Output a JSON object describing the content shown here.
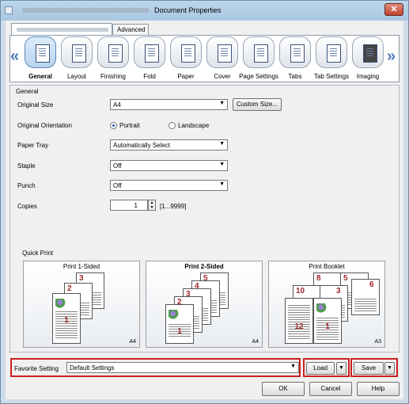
{
  "window": {
    "title": "Document Properties",
    "close_glyph": "✕"
  },
  "tabs": [
    {
      "label": "Advanced"
    }
  ],
  "categories": [
    {
      "label": "General",
      "selected": true
    },
    {
      "label": "Layout"
    },
    {
      "label": "Finishing"
    },
    {
      "label": "Fold"
    },
    {
      "label": "Paper"
    },
    {
      "label": "Cover"
    },
    {
      "label": "Page Settings"
    },
    {
      "label": "Tabs"
    },
    {
      "label": "Tab Settings"
    },
    {
      "label": "Imaging"
    }
  ],
  "nav": {
    "left": "«",
    "right": "»"
  },
  "general": {
    "group_title": "General",
    "original_size": {
      "label": "Original Size",
      "value": "A4",
      "custom_button": "Custom Size..."
    },
    "orientation": {
      "label": "Original Orientation",
      "portrait": "Portrait",
      "landscape": "Landscape",
      "selected": "Portrait"
    },
    "paper_tray": {
      "label": "Paper Tray",
      "value": "Automatically Select"
    },
    "staple": {
      "label": "Staple",
      "value": "Off"
    },
    "punch": {
      "label": "Punch",
      "value": "Off"
    },
    "copies": {
      "label": "Copies",
      "value": "1",
      "range": "[1...9999]"
    }
  },
  "quick_print": {
    "title": "Quick Print",
    "options": [
      {
        "label": "Print 1-Sided",
        "size": "A4",
        "pages": [
          "3",
          "2",
          "1"
        ]
      },
      {
        "label": "Print 2-Sided",
        "size": "A4",
        "pages": [
          "5",
          "4",
          "3",
          "2",
          "1"
        ]
      },
      {
        "label": "Print Booklet",
        "size": "A3",
        "pages": [
          "8",
          "5",
          "6",
          "10",
          "3",
          "12",
          "1"
        ]
      }
    ]
  },
  "favorite": {
    "label": "Favorite Setting",
    "value": "Default Settings",
    "load": "Load",
    "save": "Save"
  },
  "footer": {
    "ok": "OK",
    "cancel": "Cancel",
    "help": "Help"
  },
  "colors": {
    "highlight": "#cc1f1f",
    "selected_tab": "#b8d3ee"
  }
}
